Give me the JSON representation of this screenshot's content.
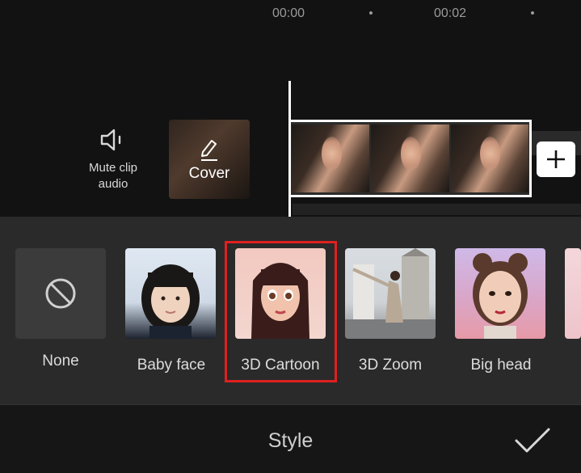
{
  "timeline": {
    "time_start": "00:00",
    "time_mid": "00:02",
    "mute_label_line1": "Mute clip",
    "mute_label_line2": "audio",
    "cover_label": "Cover"
  },
  "styles": {
    "items": [
      {
        "label": "None",
        "icon": "none-icon"
      },
      {
        "label": "Baby face"
      },
      {
        "label": "3D Cartoon",
        "highlighted": true
      },
      {
        "label": "3D Zoom"
      },
      {
        "label": "Big head"
      }
    ],
    "highlight_color": "#e02020"
  },
  "bottom": {
    "title": "Style",
    "confirm_icon": "checkmark-icon"
  }
}
